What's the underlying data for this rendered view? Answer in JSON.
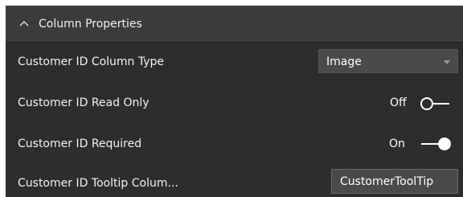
{
  "section": {
    "title": "Column Properties",
    "expanded": true
  },
  "rows": [
    {
      "label": "Customer ID Column Type",
      "control": "dropdown",
      "value": "Image"
    },
    {
      "label": "Customer ID Read Only",
      "control": "toggle",
      "state_label": "Off",
      "checked": false
    },
    {
      "label": "Customer ID Required",
      "control": "toggle",
      "state_label": "On",
      "checked": true
    },
    {
      "label": "Customer ID Tooltip Colum...",
      "control": "text-input",
      "value": "CustomerToolTip"
    }
  ],
  "colors": {
    "panel_bg": "#2d2d2d",
    "header_bg": "#3b3b3b",
    "text": "#f2f2f2",
    "input_bg": "#4a4a4a",
    "clipped_text": "#2e9e3d"
  }
}
